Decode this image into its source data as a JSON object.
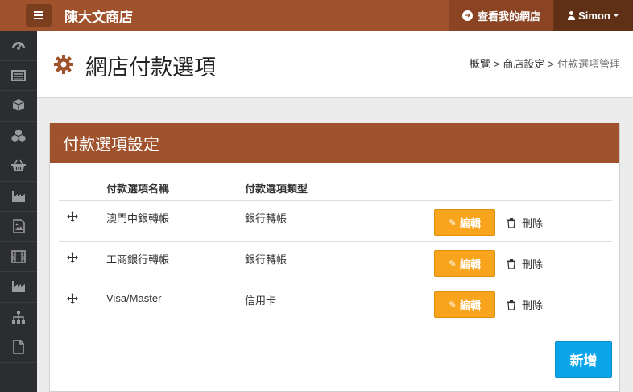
{
  "topbar": {
    "store_title": "陳大文商店",
    "view_store_label": "查看我的網店",
    "user_name": "Simon"
  },
  "sidebar": {
    "items": [
      {
        "icon": "dashboard-icon"
      },
      {
        "icon": "list-icon"
      },
      {
        "icon": "cube-icon"
      },
      {
        "icon": "cubes-icon"
      },
      {
        "icon": "basket-icon"
      },
      {
        "icon": "industry-icon"
      },
      {
        "icon": "image-icon"
      },
      {
        "icon": "film-icon"
      },
      {
        "icon": "factory-icon"
      },
      {
        "icon": "sitemap-icon"
      },
      {
        "icon": "file-icon"
      }
    ]
  },
  "header": {
    "title": "網店付款選項",
    "breadcrumb": [
      "概覽",
      "商店設定",
      "付款選項管理"
    ]
  },
  "panel": {
    "heading": "付款選項設定",
    "columns": [
      "付款選項名稱",
      "付款選項類型"
    ],
    "rows": [
      {
        "name": "澳門中銀轉帳",
        "type": "銀行轉帳"
      },
      {
        "name": "工商銀行轉帳",
        "type": "銀行轉帳"
      },
      {
        "name": "Visa/Master",
        "type": "信用卡"
      }
    ],
    "edit_label": "編輯",
    "delete_label": "刪除",
    "add_label": "新增"
  },
  "colors": {
    "brand": "#a0522d",
    "edit": "#f8a41d",
    "add": "#0aa5e8",
    "sidebar": "#2c2d30"
  }
}
